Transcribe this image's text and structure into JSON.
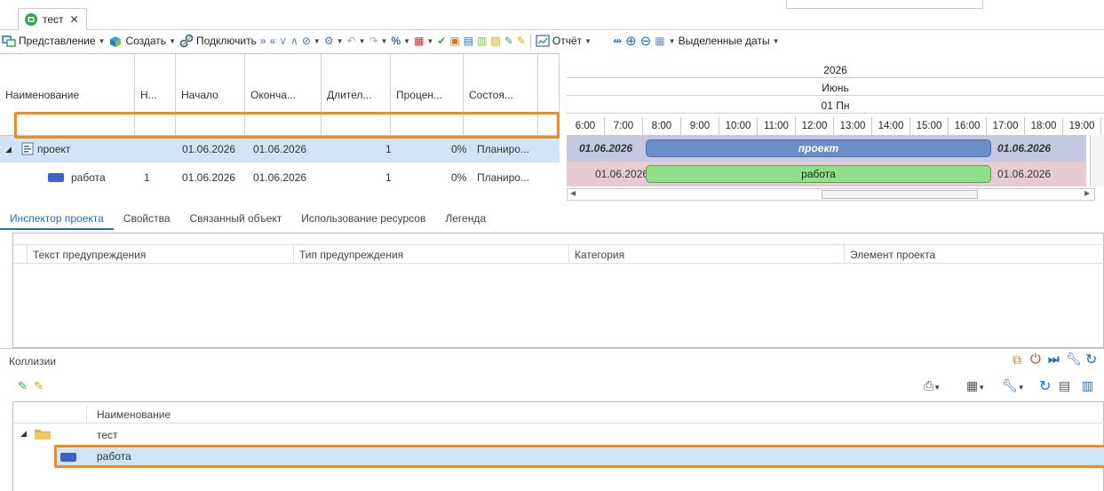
{
  "document_tab": {
    "title": "тест",
    "close": "✕"
  },
  "toolbar": {
    "view_label": "Представление",
    "create_label": "Создать",
    "connect_label": "Подключить",
    "report_label": "Отчёт",
    "selected_dates_label": "Выделенные даты"
  },
  "grid": {
    "columns": [
      "Наименование",
      "Н...",
      "Начало",
      "Оконча...",
      "Длител...",
      "Процен...",
      "Состоя..."
    ],
    "rows": [
      {
        "name": "проект",
        "n": "",
        "start": "01.06.2026",
        "end": "01.06.2026",
        "duration": "1",
        "percent": "0%",
        "state": "Планиро..."
      },
      {
        "name": "работа",
        "n": "1",
        "start": "01.06.2026",
        "end": "01.06.2026",
        "duration": "1",
        "percent": "0%",
        "state": "Планиро..."
      }
    ]
  },
  "gantt": {
    "year": "2026",
    "month": "Июнь",
    "day": "01 Пн",
    "hours": [
      "6:00",
      "7:00",
      "8:00",
      "9:00",
      "10:00",
      "11:00",
      "12:00",
      "13:00",
      "14:00",
      "15:00",
      "16:00",
      "17:00",
      "18:00",
      "19:00"
    ],
    "project_bar": {
      "start_label": "01.06.2026",
      "label": "проект",
      "end_label": "01.06.2026"
    },
    "task_bar": {
      "start_label": "01.06.2026",
      "label": "работа",
      "end_label": "01.06.2026"
    },
    "colors": {
      "project_bar": "#6a8fc8",
      "task_bar": "#90e08a",
      "project_row": "#c6c8e2",
      "task_row": "#e6ccd2"
    }
  },
  "inspector_tabs": [
    "Инспектор проекта",
    "Свойства",
    "Связанный объект",
    "Использование ресурсов",
    "Легенда"
  ],
  "warnings": {
    "columns": [
      "Текст предупреждения",
      "Тип предупреждения",
      "Категория",
      "Элемент проекта"
    ]
  },
  "collisions": {
    "title": "Коллизии",
    "tree_header": "Наименование",
    "tree_items": [
      "тест",
      "работа"
    ]
  },
  "accent_color": "#f08c1e"
}
